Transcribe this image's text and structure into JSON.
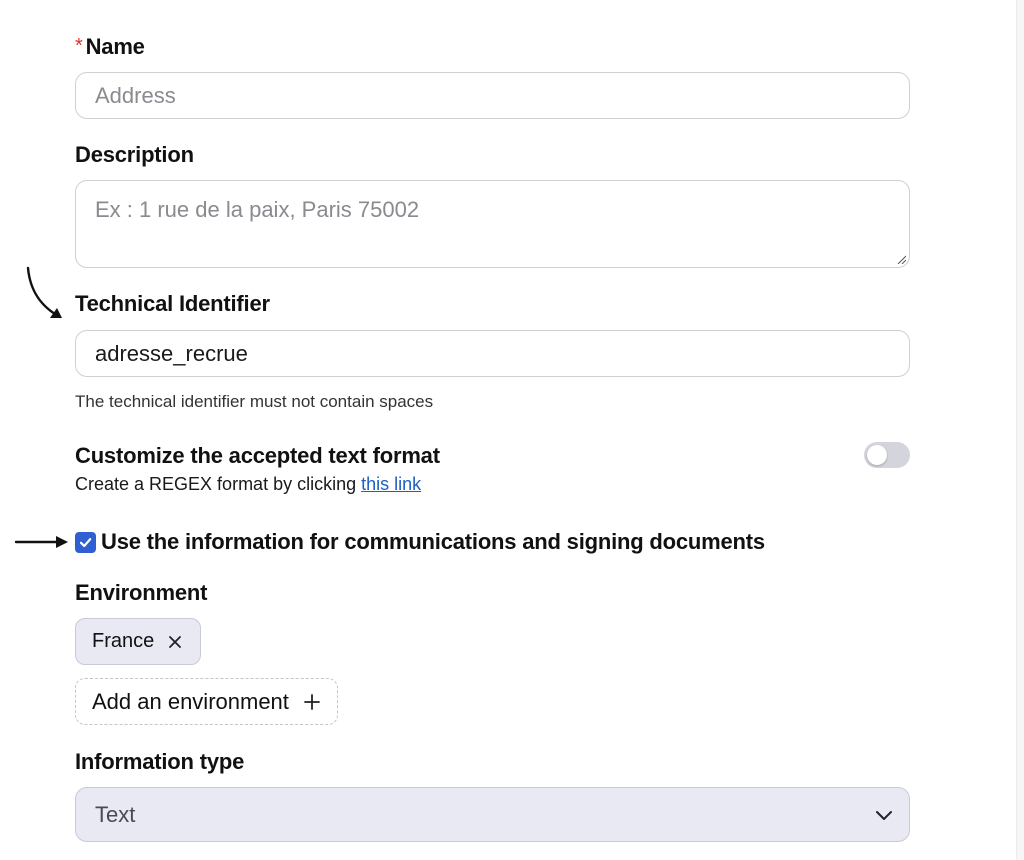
{
  "form": {
    "name": {
      "label": "Name",
      "required_marker": "*",
      "placeholder": "Address"
    },
    "description": {
      "label": "Description",
      "placeholder": "Ex : 1 rue de la paix, Paris 75002"
    },
    "technical_identifier": {
      "label": "Technical Identifier",
      "value": "adresse_recrue",
      "helper": "The technical identifier must not contain spaces"
    },
    "text_format": {
      "label": "Customize the accepted text format",
      "description_prefix": "Create a REGEX format by clicking ",
      "link_text": "this link",
      "toggle_on": false
    },
    "use_info": {
      "label": "Use the information for communications and signing documents",
      "checked": true
    },
    "environment": {
      "label": "Environment",
      "chips": [
        "France"
      ],
      "add_label": "Add an environment"
    },
    "information_type": {
      "label": "Information type",
      "selected": "Text"
    }
  },
  "colors": {
    "accent": "#2f5fd3",
    "link": "#1d5fc6",
    "required": "#d9342b",
    "chip_bg": "#e8e9f3"
  }
}
